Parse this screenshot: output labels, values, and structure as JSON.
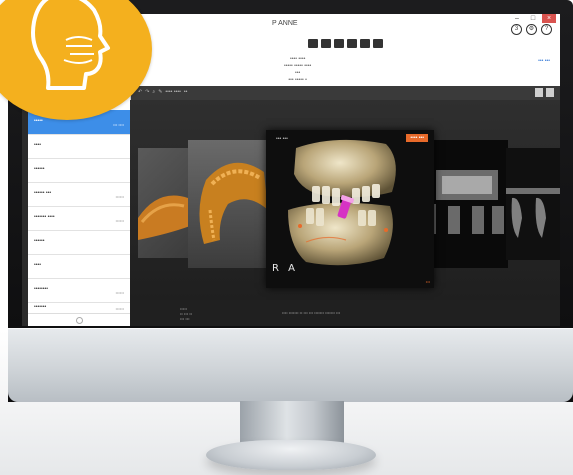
{
  "window": {
    "title": "P ANNE",
    "controls": [
      "–",
      "□",
      "×"
    ]
  },
  "top_icons": [
    "3",
    "⚙",
    "?"
  ],
  "infobar": {
    "lines": [
      "•••• ••••",
      "•••••  ••••• ••••",
      "•••",
      "••• ••••• •"
    ],
    "link": "••• •••"
  },
  "viewerbar": {
    "tools": [
      "↶",
      "↷",
      "⌕",
      "✎",
      "•••• ••••",
      "••"
    ]
  },
  "sidebar": {
    "items": [
      {
        "label": "•••• ••••",
        "meta": "•• ••••"
      },
      {
        "label": "•••••",
        "meta": "••• ••••"
      },
      {
        "label": "••••",
        "meta": ""
      },
      {
        "label": "••••••",
        "meta": ""
      },
      {
        "label": "•••••• •••",
        "meta": "••••••"
      },
      {
        "label": "••••••• ••••",
        "meta": "••••••"
      },
      {
        "label": "••••••",
        "meta": ""
      },
      {
        "label": "••••",
        "meta": ""
      },
      {
        "label": "••••••••",
        "meta": "••••••"
      },
      {
        "label": "•••••••",
        "meta": "••••••"
      }
    ],
    "active_index": 1
  },
  "viewer": {
    "main_label": "••• •••",
    "main_badge": "•••• •••",
    "orientation_letters": "R A",
    "main_footer": "•••"
  },
  "statusbar": {
    "left_lines": [
      "•••••",
      "•• ••• ••",
      "••• •••"
    ],
    "middle": "•••• ••••••• •• ••• ••• ••••••• ••••••• •••"
  },
  "colors": {
    "badge": "#f4b01e",
    "accent_orange": "#e86a2a",
    "selection_blue": "#3d8ee8"
  },
  "icons": {
    "logo": "head-profile-icon"
  }
}
